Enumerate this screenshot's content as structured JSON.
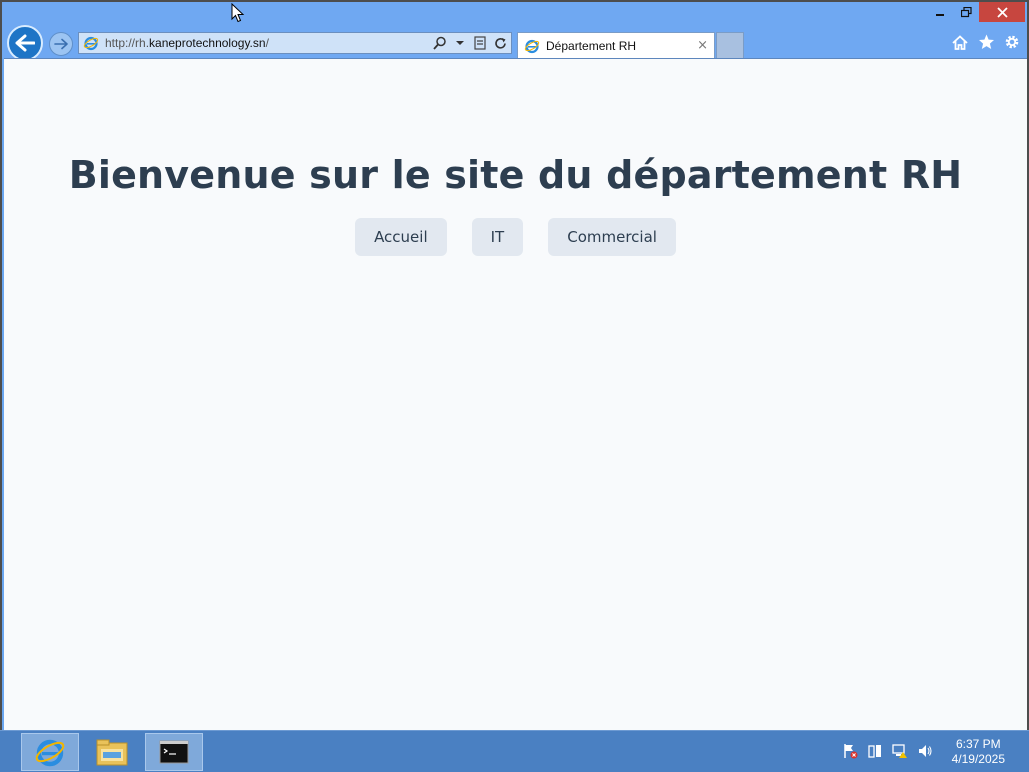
{
  "browser": {
    "url_prefix": "http://rh.",
    "url_domain": "kaneprotechnology.sn",
    "url_suffix": "/",
    "tab_title": "Département RH",
    "tab_close": "×"
  },
  "page": {
    "heading": "Bienvenue sur le site du département RH",
    "nav": [
      {
        "label": "Accueil"
      },
      {
        "label": "IT"
      },
      {
        "label": "Commercial"
      }
    ]
  },
  "taskbar": {
    "time": "6:37 PM",
    "date": "4/19/2025"
  },
  "colors": {
    "heading": "#2d3e50",
    "nav_button_bg": "#e2e8f0",
    "page_bg": "#f8fafc",
    "titlebar": "#6fa8f2",
    "taskbar": "#4a80c2"
  },
  "icons": {
    "back": "arrow-left-icon",
    "forward": "arrow-right-icon",
    "ie": "internet-explorer-icon",
    "search": "search-icon",
    "compat": "compatibility-view-icon",
    "refresh": "refresh-icon",
    "home": "home-icon",
    "favorites": "star-icon",
    "settings": "gear-icon"
  }
}
